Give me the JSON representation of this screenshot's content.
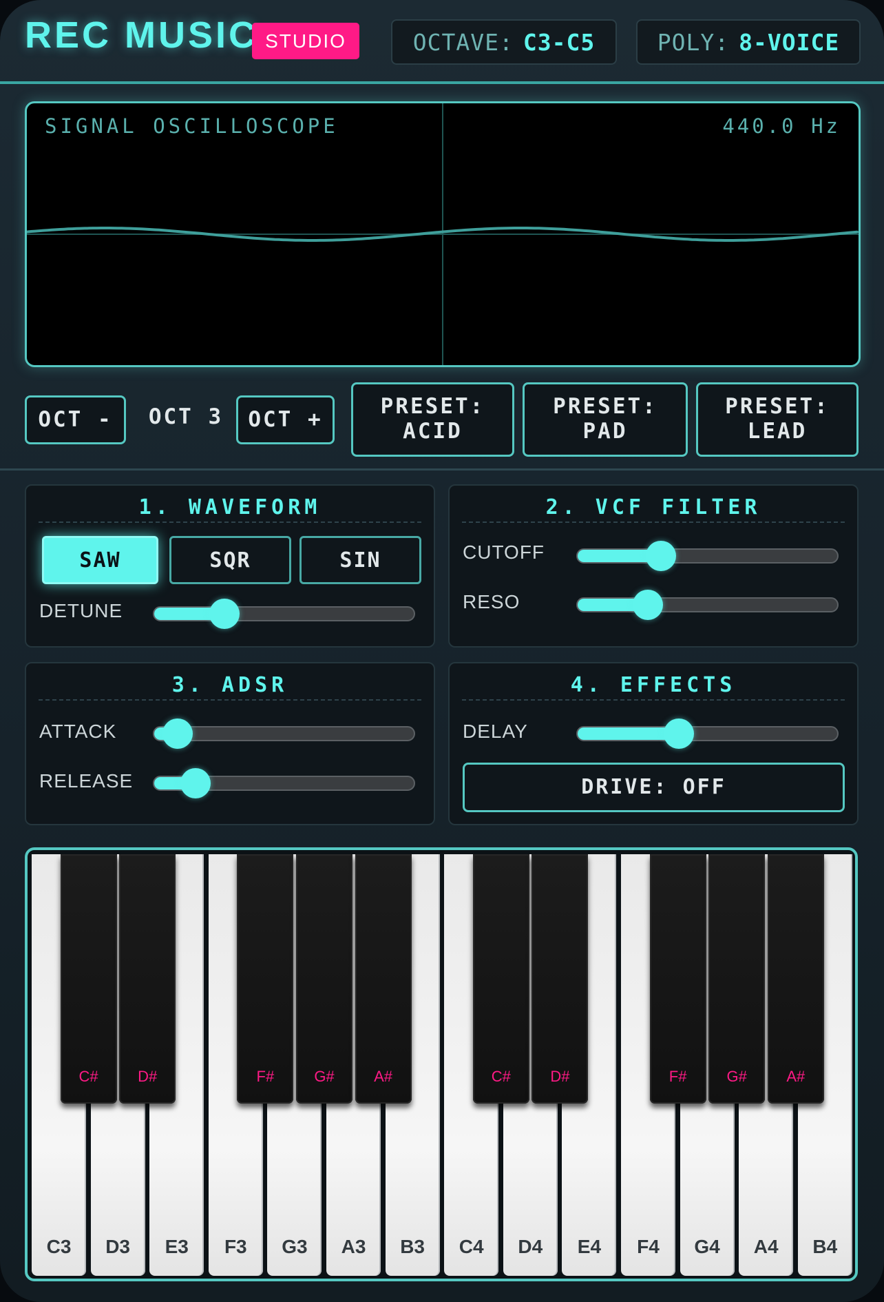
{
  "header": {
    "brand": "REC MUSIC",
    "badge": "STUDIO",
    "octave_label": "OCTAVE:",
    "octave_value": "C3-C5",
    "poly_label": "POLY:",
    "poly_value": "8-VOICE"
  },
  "scope": {
    "title": "SIGNAL OSCILLOSCOPE",
    "frequency": "440.0 Hz"
  },
  "controls": {
    "oct_down": "OCT -",
    "oct_current": "OCT 3",
    "oct_up": "OCT +",
    "presets": [
      "PRESET: ACID",
      "PRESET: PAD",
      "PRESET: LEAD"
    ]
  },
  "panels": {
    "waveform": {
      "title": "1. WAVEFORM",
      "buttons": [
        "SAW",
        "SQR",
        "SIN"
      ],
      "selected": "SAW",
      "detune_label": "DETUNE",
      "detune_value": 0.27
    },
    "filter": {
      "title": "2. VCF FILTER",
      "cutoff_label": "CUTOFF",
      "cutoff_value": 0.32,
      "reso_label": "RESO",
      "reso_value": 0.27
    },
    "adsr": {
      "title": "3. ADSR",
      "attack_label": "ATTACK",
      "attack_value": 0.09,
      "release_label": "RELEASE",
      "release_value": 0.16
    },
    "effects": {
      "title": "4. EFFECTS",
      "delay_label": "DELAY",
      "delay_value": 0.39,
      "drive_label": "DRIVE: OFF"
    }
  },
  "keyboard": {
    "white_keys": [
      "C3",
      "D3",
      "E3",
      "F3",
      "G3",
      "A3",
      "B3",
      "C4",
      "D4",
      "E4",
      "F4",
      "G4",
      "A4",
      "B4"
    ],
    "black_keys": [
      "C#",
      "D#",
      "F#",
      "G#",
      "A#",
      "C#",
      "D#",
      "F#",
      "G#",
      "A#"
    ]
  },
  "colors": {
    "accent": "#5ff4ec",
    "badge": "#ff1a86",
    "border": "#55c8c2"
  }
}
